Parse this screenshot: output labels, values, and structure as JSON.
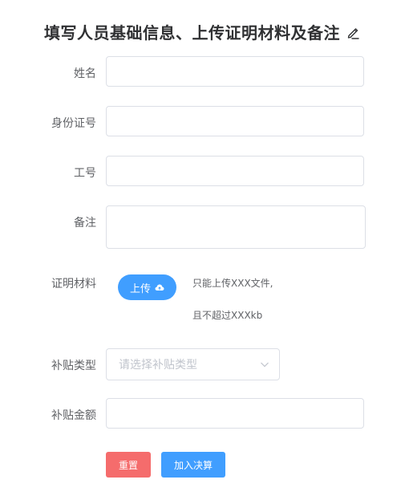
{
  "form": {
    "title": "填写人员基础信息、上传证明材料及备注",
    "title_icon": "edit-icon",
    "fields": {
      "name_label": "姓名",
      "name_value": "",
      "id_card_label": "身份证号",
      "id_card_value": "",
      "employee_no_label": "工号",
      "employee_no_value": "",
      "remark_label": "备注",
      "remark_value": "",
      "proof_label": "证明材料",
      "upload_label": "上传",
      "upload_icon": "cloud-upload-icon",
      "upload_hint_line1": "只能上传XXX文件,",
      "upload_hint_line2": "且不超过XXXkb",
      "subsidy_type_label": "补贴类型",
      "subsidy_type_placeholder": "请选择补贴类型",
      "subsidy_amount_label": "补贴金额",
      "subsidy_amount_value": ""
    },
    "actions": {
      "reset_label": "重置",
      "submit_label": "加入决算"
    }
  },
  "colors": {
    "primary": "#409eff",
    "danger": "#f56c6c",
    "border": "#dcdfe6",
    "placeholder": "#c0c4cc",
    "title": "#303133",
    "label": "#606266"
  }
}
